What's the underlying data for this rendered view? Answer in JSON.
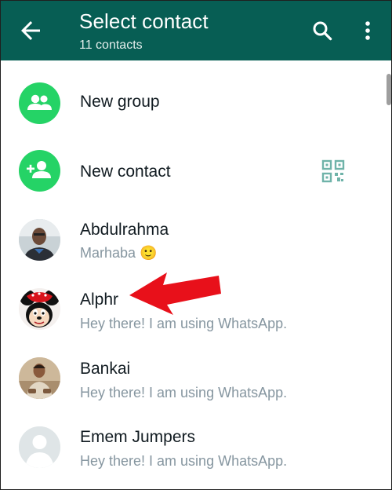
{
  "app_bar": {
    "title": "Select contact",
    "subtitle": "11 contacts",
    "background": "#075e54"
  },
  "actions": [
    {
      "label": "New group",
      "icon": "group-icon"
    },
    {
      "label": "New contact",
      "icon": "add-person-icon",
      "trailing_icon": "qr-code-icon"
    }
  ],
  "contacts": [
    {
      "name": "Abdulrahma",
      "status": "Marhaba 🙂",
      "avatar": "photo-man"
    },
    {
      "name": "Alphr",
      "status": "Hey there! I am using WhatsApp.",
      "avatar": "minnie-mouse"
    },
    {
      "name": "Bankai",
      "status": "Hey there! I am using WhatsApp.",
      "avatar": "photo-man-sitting"
    },
    {
      "name": "Emem Jumpers",
      "status": "Hey there! I am using WhatsApp.",
      "avatar": "default-person"
    }
  ],
  "accent_green": "#25d366",
  "annotation_arrow_color": "#e8101a"
}
